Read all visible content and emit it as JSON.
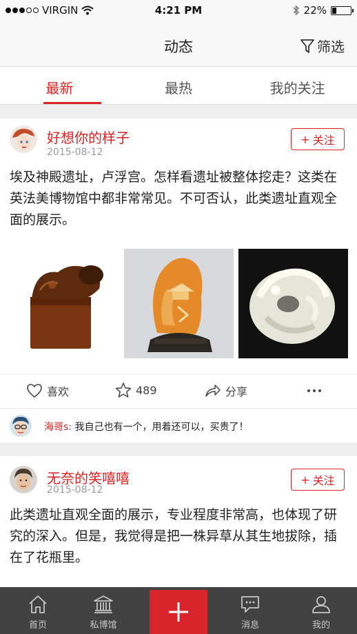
{
  "status_bar": {
    "carrier": "VIRGIN",
    "time": "4:21 PM",
    "battery": "22%",
    "battery_level": 0.22
  },
  "nav": {
    "title": "动态",
    "filter_label": "筛选"
  },
  "tabs": [
    {
      "label": "最新",
      "active": true
    },
    {
      "label": "最热",
      "active": false
    },
    {
      "label": "我的关注",
      "active": false
    }
  ],
  "posts": [
    {
      "author": "好想你的样子",
      "date": "2015-08-12",
      "follow_label": "关注",
      "text": "埃及神殿遗址，卢浮宫。怎样看遗址被整体挖走？这类在英法美博物馆中都非常常见。不可否认，此类遗址直观全面的展示。",
      "images": [
        "brown-stone-seal",
        "orange-carved-stone",
        "white-jade-carving"
      ],
      "actions": {
        "like": "喜欢",
        "favorite_count": "489",
        "share": "分享"
      },
      "comment": {
        "user": "海哥s:",
        "text": "我自己也有一个，用着还可以，买贵了！"
      }
    },
    {
      "author": "无奈的笑嘻嘻",
      "date": "2015-08-12",
      "follow_label": "关注",
      "text": "此类遗址直观全面的展示，专业程度非常高，也体现了研究的深入。但是，我觉得是把一株异草从其生地拔除，插在了花瓶里。"
    }
  ],
  "bottom_tabs": [
    {
      "label": "首页",
      "icon": "home-icon"
    },
    {
      "label": "私博馆",
      "icon": "museum-icon"
    },
    {
      "label": "",
      "icon": "plus-icon"
    },
    {
      "label": "消息",
      "icon": "message-icon"
    },
    {
      "label": "我的",
      "icon": "profile-icon"
    }
  ],
  "colors": {
    "accent": "#d22222",
    "add_button": "#d8242a",
    "tabbar_bg": "#323232"
  }
}
